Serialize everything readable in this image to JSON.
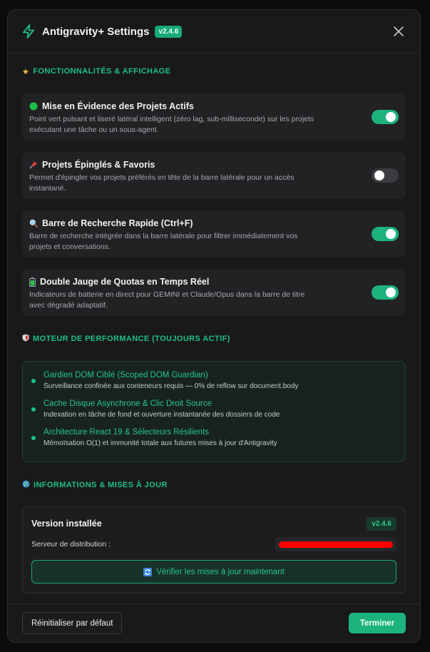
{
  "header": {
    "title": "Antigravity+ Settings",
    "version_badge": "v2.4.6",
    "icon": "bolt-icon"
  },
  "colors": {
    "accent": "#1cb37c",
    "toggle_off": "#3b3b40",
    "background": "#19191b"
  },
  "features": {
    "section_title": "FONCTIONNALITÉS & AFFICHAGE",
    "section_emoji": "★",
    "items": [
      {
        "emoji": "green-circle-icon",
        "title": "Mise en Évidence des Projets Actifs",
        "description": "Point vert pulsant et liseré latéral intelligent (zéro lag, sub-milliseconde) sur les projets exécutant une tâche ou un sous-agent.",
        "enabled": true
      },
      {
        "emoji": "pushpin-icon",
        "title": "Projets Épinglés & Favoris",
        "description": "Permet d'épingler vos projets préférés en tête de la barre latérale pour un accès instantané.",
        "enabled": false
      },
      {
        "emoji": "magnifier-icon",
        "title": "Barre de Recherche Rapide (Ctrl+F)",
        "description": "Barre de recherche intégrée dans la barre latérale pour filtrer immédiatement vos projets et conversations.",
        "enabled": true
      },
      {
        "emoji": "battery-icon",
        "title": "Double Jauge de Quotas en Temps Réel",
        "description": "Indicateurs de batterie en direct pour GEMINI et Claude/Opus dans la barre de titre avec dégradé adaptatif.",
        "enabled": true
      }
    ]
  },
  "performance": {
    "section_title": "MOTEUR DE PERFORMANCE (TOUJOURS ACTIF)",
    "section_emoji": "shield-icon",
    "items": [
      {
        "title": "Gardien DOM Ciblé (Scoped DOM Guardian)",
        "description": "Surveillance confinée aux conteneurs requis — 0% de reflow sur document.body"
      },
      {
        "title": "Cache Disque Asynchrone & Clic Droit Source",
        "description": "Indexation en tâche de fond et ouverture instantanée des dossiers de code"
      },
      {
        "title": "Architecture React 19 & Sélecteurs Résilients",
        "description": "Mémoïsation O(1) et immunité totale aux futures mises à jour d'Antigravity"
      }
    ]
  },
  "info": {
    "section_title": "INFORMATIONS & MISES À JOUR",
    "section_emoji": "globe-icon",
    "installed_label": "Version installée",
    "installed_version": "v2.4.6",
    "server_label": "Serveur de distribution :",
    "check_button": "Vérifier les mises à jour maintenant",
    "check_icon": "refresh-icon"
  },
  "footer": {
    "reset_label": "Réinitialiser par défaut",
    "done_label": "Terminer"
  }
}
